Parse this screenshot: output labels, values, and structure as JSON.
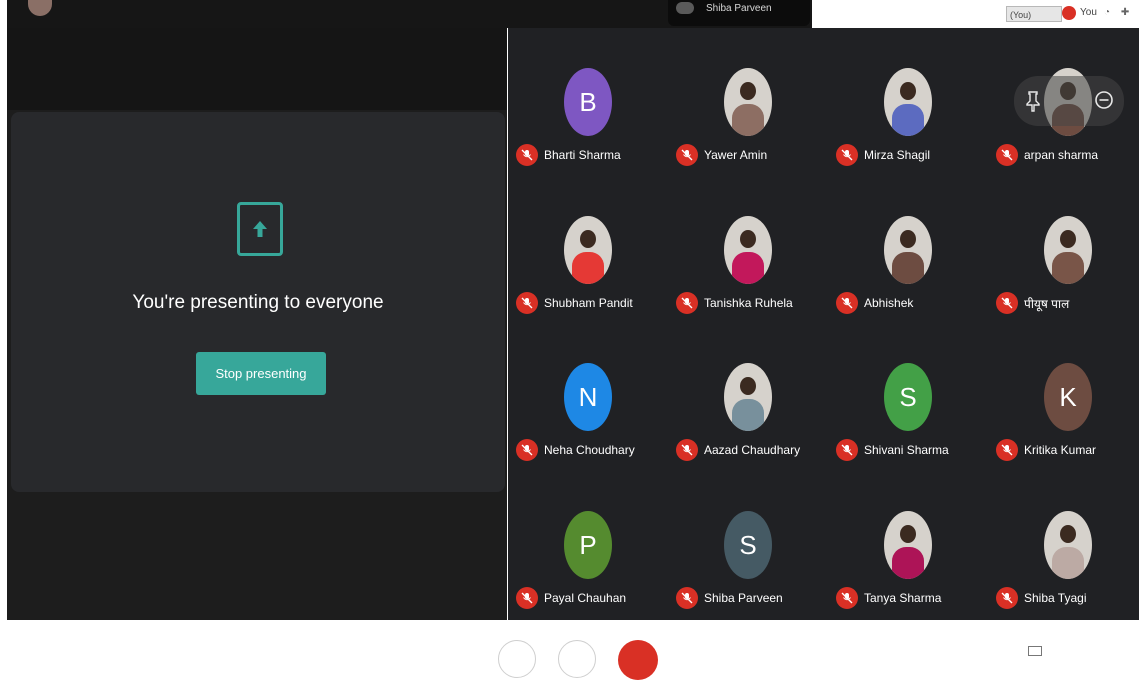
{
  "top": {
    "tab_label": "Shiba Parveen",
    "you_chip": "(You)",
    "you_label": "You"
  },
  "presentation": {
    "message": "You're presenting to everyone",
    "stop_button": "Stop presenting",
    "accent_color": "#37a79a"
  },
  "participants": [
    {
      "name": "Bharti Sharma",
      "initial": "B",
      "color": "#7e57c2",
      "photo": false
    },
    {
      "name": "Yawer Amin",
      "initial": "",
      "color": "#8d6e63",
      "photo": true
    },
    {
      "name": "Mirza Shagil",
      "initial": "",
      "color": "#5c6bc0",
      "photo": true
    },
    {
      "name": "arpan sharma",
      "initial": "",
      "color": "#6d4c41",
      "photo": true
    },
    {
      "name": "Shubham Pandit",
      "initial": "",
      "color": "#e53935",
      "photo": true
    },
    {
      "name": "Tanishka Ruhela",
      "initial": "",
      "color": "#c2185b",
      "photo": true
    },
    {
      "name": "Abhishek",
      "initial": "",
      "color": "#6d4c41",
      "photo": true
    },
    {
      "name": "पीयूष पाल",
      "initial": "",
      "color": "#795548",
      "photo": true
    },
    {
      "name": "Neha Choudhary",
      "initial": "N",
      "color": "#1e88e5",
      "photo": false
    },
    {
      "name": "Aazad Chaudhary",
      "initial": "",
      "color": "#78909c",
      "photo": true
    },
    {
      "name": "Shivani Sharma",
      "initial": "S",
      "color": "#43a047",
      "photo": false
    },
    {
      "name": "Kritika Kumar",
      "initial": "K",
      "color": "#6d4c41",
      "photo": false
    },
    {
      "name": "Payal Chauhan",
      "initial": "P",
      "color": "#558b2f",
      "photo": false
    },
    {
      "name": "Shiba Parveen",
      "initial": "S",
      "color": "#455a64",
      "photo": false
    },
    {
      "name": "Tanya Sharma",
      "initial": "",
      "color": "#ad1457",
      "photo": true
    },
    {
      "name": "Shiba Tyagi",
      "initial": "",
      "color": "#bcaaa4",
      "photo": true
    }
  ],
  "icons": {
    "mute": "mic-off-icon",
    "present": "present-arrow-icon",
    "pin": "pin-icon",
    "remove": "remove-icon"
  },
  "colors": {
    "muted_badge": "#d93025",
    "grid_background": "#202124",
    "end_call": "#d93025"
  }
}
